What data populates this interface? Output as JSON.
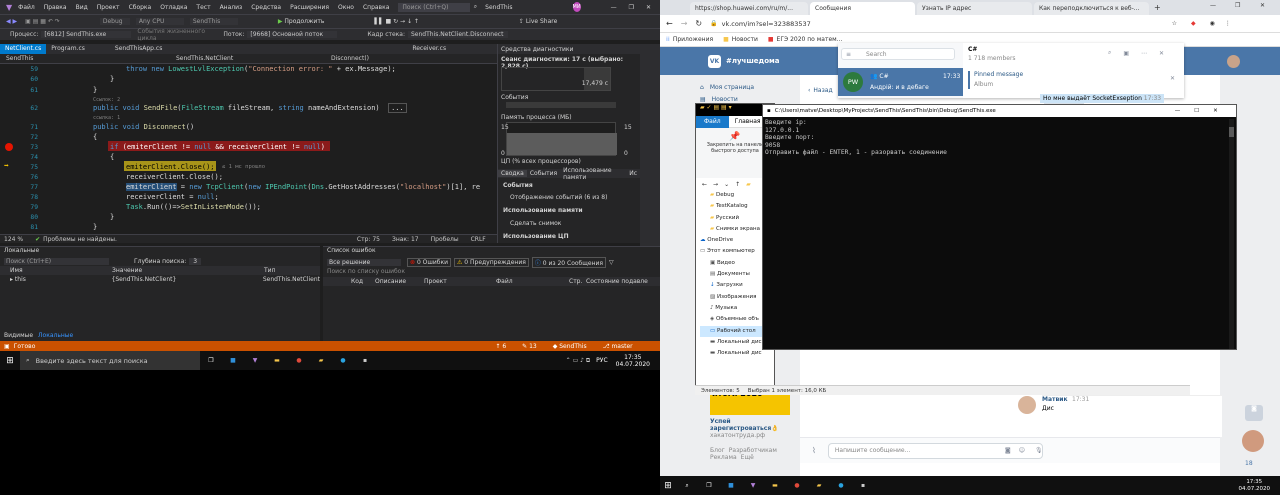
{
  "vs": {
    "menu": [
      "Файл",
      "Правка",
      "Вид",
      "Проект",
      "Сборка",
      "Отладка",
      "Тест",
      "Анализ",
      "Средства",
      "Расширения",
      "Окно",
      "Справка"
    ],
    "search_placeholder": "Поиск (Ctrl+Q)",
    "solution_title": "SendThis",
    "live_share": "Live Share",
    "toolbar_config": "Debug",
    "toolbar_platform": "Any CPU",
    "toolbar_project": "SendThis",
    "toolbar_continue": "Продолжить",
    "process_label": "Процесс:",
    "process_value": "[6812] SendThis.exe",
    "lifecycle_label": "События жизненного цикла",
    "thread_label": "Поток:",
    "thread_value": "[9668] Основной поток",
    "frame_label": "Кадр стека:",
    "frame_value": "SendThis.NetClient.Disconnect",
    "tabs": [
      "NetClient.cs",
      "Program.cs",
      "SendThisApp.cs",
      "Receiver.cs"
    ],
    "crumb_project": "SendThis",
    "crumb_class": "SendThis.NetClient",
    "crumb_member": "Disconnect()",
    "lines": [
      {
        "n": "59",
        "text": "throw new LowestLvlException(\"Connection error: \" + ex.Message);"
      },
      {
        "n": "60",
        "text": "}"
      },
      {
        "n": "61",
        "text": "}"
      },
      {
        "n": "",
        "text": "Ссылок: 2"
      },
      {
        "n": "62",
        "text": "public void SendFile(FileStream fileStream, string nameAndExtension)"
      },
      {
        "n": "",
        "text": "ссылка: 1"
      },
      {
        "n": "71",
        "text": "public void Disconnect()"
      },
      {
        "n": "72",
        "text": "{"
      },
      {
        "n": "73",
        "text": "if (emiterClient != null && receiverClient != null)"
      },
      {
        "n": "74",
        "text": "{"
      },
      {
        "n": "75",
        "text": "emiterClient.Close();"
      },
      {
        "n": "76",
        "text": "receiverClient.Close();"
      },
      {
        "n": "77",
        "text": "emiterClient = new TcpClient(new IPEndPoint(Dns.GetHostAddresses(\"localhost\")[1], re"
      },
      {
        "n": "78",
        "text": "receiverClient = null;"
      },
      {
        "n": "79",
        "text": "Task.Run(()=>SetInListenMode());"
      },
      {
        "n": "80",
        "text": "}"
      },
      {
        "n": "81",
        "text": "}"
      }
    ],
    "elapsed_hint": "≤ 1 мс прошло",
    "zoom": "124 %",
    "no_problems": "Проблемы не найдены.",
    "cursor_pos": "Стр: 75",
    "cursor_col": "Знак: 17",
    "spaces": "Пробелы",
    "eol": "CRLF",
    "diag_title": "Средства диагностики",
    "diag_session": "Сеанс диагностики: 17 с (выбрано: 2,828 с)",
    "diag_time": "17,479 с",
    "diag_events": "События",
    "diag_memory": "Память процесса (МБ)",
    "diag_mem_max": "15",
    "diag_mem_min": "0",
    "diag_cpu": "ЦП (% всех процессоров)",
    "diag_cpu_max": "100",
    "diag_cpu_min": "0",
    "diag_tabs": [
      "Сводка",
      "События",
      "Использование памяти",
      "Ис"
    ],
    "diag_events_head": "События",
    "diag_events_item": "Отображение событий (6 из 8)",
    "diag_mem_head": "Использование памяти",
    "diag_snapshot": "Сделать снимок",
    "diag_cpu_head": "Использование ЦП",
    "locals_title": "Локальные",
    "locals_search": "Поиск (Ctrl+E)",
    "locals_depth_label": "Глубина поиска:",
    "locals_depth": "3",
    "locals_cols": [
      "Имя",
      "Значение",
      "Тип"
    ],
    "locals_row": {
      "name": "this",
      "value": "{SendThis.NetClient}",
      "type": "SendThis.NetClient"
    },
    "locals_tabs": [
      "Видимые",
      "Локальные"
    ],
    "errors_title": "Список ошибок",
    "errors_scope": "Все решение",
    "errors_errors": "0 Ошибки",
    "errors_warnings": "0 Предупреждения",
    "errors_messages": "0 из 20 Сообщения",
    "errors_search": "Поиск по списку ошибок",
    "errors_cols": [
      "Код",
      "Описание",
      "Проект",
      "Файл",
      "Стр.",
      "Состояние подавле"
    ],
    "status_ready": "Готово",
    "status_up": "6",
    "status_pencil": "0",
    "status_changes": "13",
    "status_repo": "SendThis",
    "status_branch": "master"
  },
  "taskbar": {
    "search_placeholder": "Введите здесь текст для поиска",
    "lang": "РУС",
    "time": "17:35",
    "date": "04.07.2020"
  },
  "browser": {
    "tabs": [
      "https://shop.huawei.com/ru/m/...",
      "Сообщения",
      "Узнать IP адрес",
      "Как переподключиться к веб-..."
    ],
    "url": "vk.com/im?sel=323883537",
    "bookmarks": [
      "Приложения",
      "Новости",
      "ЕГЭ 2020 по матем..."
    ],
    "vk_brand": "#лучшедома",
    "vk_search": "Search",
    "left_menu": [
      "Моя страница",
      "Новости"
    ],
    "back_label": "Назад",
    "chat_title": "C#",
    "chat_members": "1 718 members",
    "chat_item_name": "C#",
    "chat_item_time": "17:33",
    "chat_item_text": "Андрій: и в дебаге",
    "chat_avatar": "PW",
    "pinned_title": "Pinned message",
    "pinned_sub": "Album",
    "msg_bubble": "Но мне выдаёт SocketExseption",
    "msg_bubble_time": "17:33",
    "msg_author": "Матвик",
    "msg_author_time": "17:31",
    "msg_text": "Дис",
    "input_placeholder": "Напишите сообщение...",
    "ad_title": "итоги 2020",
    "ad_link": "Успей зарегистроваться👌",
    "ad_domain": "хакатонтруда.рф",
    "footer_links": [
      "Блог",
      "Разработчикам",
      "Реклама",
      "Ещё"
    ],
    "counter": "18"
  },
  "explorer": {
    "tab_file": "Файл",
    "tab_home": "Главная",
    "pin_label": "Закрепить на панели быстрого доступа",
    "tree": [
      "Debug",
      "TestKatalog",
      "Русский",
      "Снимки экрана",
      "OneDrive",
      "Этот компьютер",
      "Видео",
      "Документы",
      "Загрузки",
      "Изображения",
      "Музыка",
      "Объемные объ",
      "Рабочий стол",
      "Локальный дис",
      "Локальный дис"
    ],
    "status": "Элементов: 5",
    "status_sel": "Выбран 1 элемент: 16,0 КБ"
  },
  "cmd": {
    "title": "C:\\Users\\matve\\Desktop\\MyProjects\\SendThis\\SendThis\\bin\\Debug\\SendThis.exe",
    "lines": [
      "Введите ip:",
      "127.0.0.1",
      "Введите порт:",
      "9058",
      "Отправить файл - ENTER, 1 - разорвать соединение"
    ]
  }
}
